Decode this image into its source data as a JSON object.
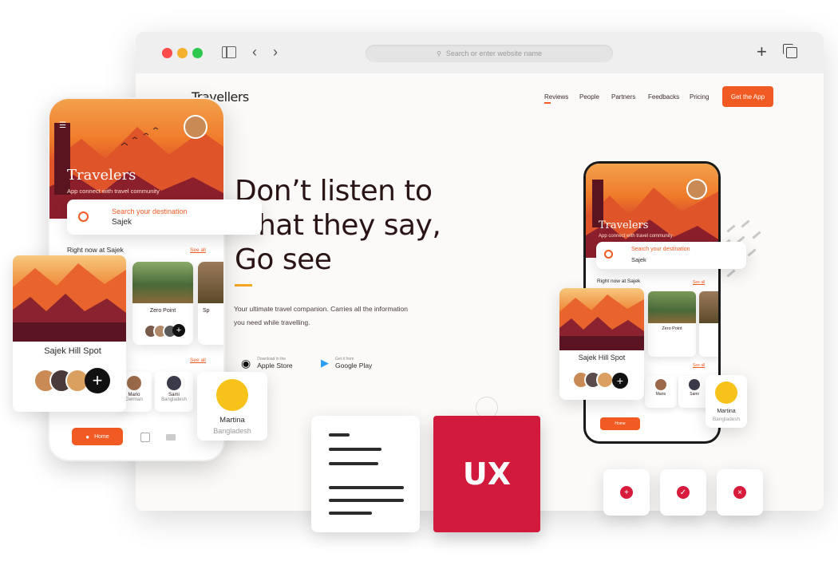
{
  "browser": {
    "url_placeholder": "Search or enter website name",
    "traffic_colors": [
      "#ff4b4b",
      "#f5b02c",
      "#2dc84d"
    ]
  },
  "site": {
    "brand": "Travellers",
    "nav": [
      "Reviews",
      "People",
      "Partners",
      "Feedbacks",
      "Pricing"
    ],
    "cta": "Get the App",
    "hero_lines": [
      "Don’t listen to",
      "what they say,",
      "Go see"
    ],
    "description_lines": [
      "Your ultimate travel companion. Carries all the information",
      "you need while travelling."
    ],
    "stores": [
      {
        "small": "Download in the",
        "big": "Apple Store",
        "icon": "apple-icon"
      },
      {
        "small": "Get it from",
        "big": "Google Play",
        "icon": "google-play-icon"
      }
    ]
  },
  "app": {
    "title": "Travelers",
    "subtitle": "App connect with travel community",
    "search_label": "Search your destination",
    "search_value": "Sajek",
    "section_title": "Right now at Sajek",
    "see_all": "See all",
    "spot_name": "Sajek Hill Spot",
    "place_card": "Zero Point",
    "place_card_partial": "Sp",
    "people": [
      {
        "name": "Mario",
        "role": "German"
      },
      {
        "name": "Sami",
        "role": "Bangladesh"
      }
    ],
    "home_tab": "Home",
    "featured_person": {
      "name": "Martina",
      "country": "Bangladesh"
    }
  },
  "badges": {
    "ux": "UX"
  },
  "actions": [
    {
      "icon": "plus-icon",
      "glyph": "+"
    },
    {
      "icon": "check-icon",
      "glyph": "✓"
    },
    {
      "icon": "close-icon",
      "glyph": "×"
    }
  ],
  "colors": {
    "accent": "#f15a22",
    "brand_red": "#d21a3c",
    "dark": "#2b1416"
  }
}
